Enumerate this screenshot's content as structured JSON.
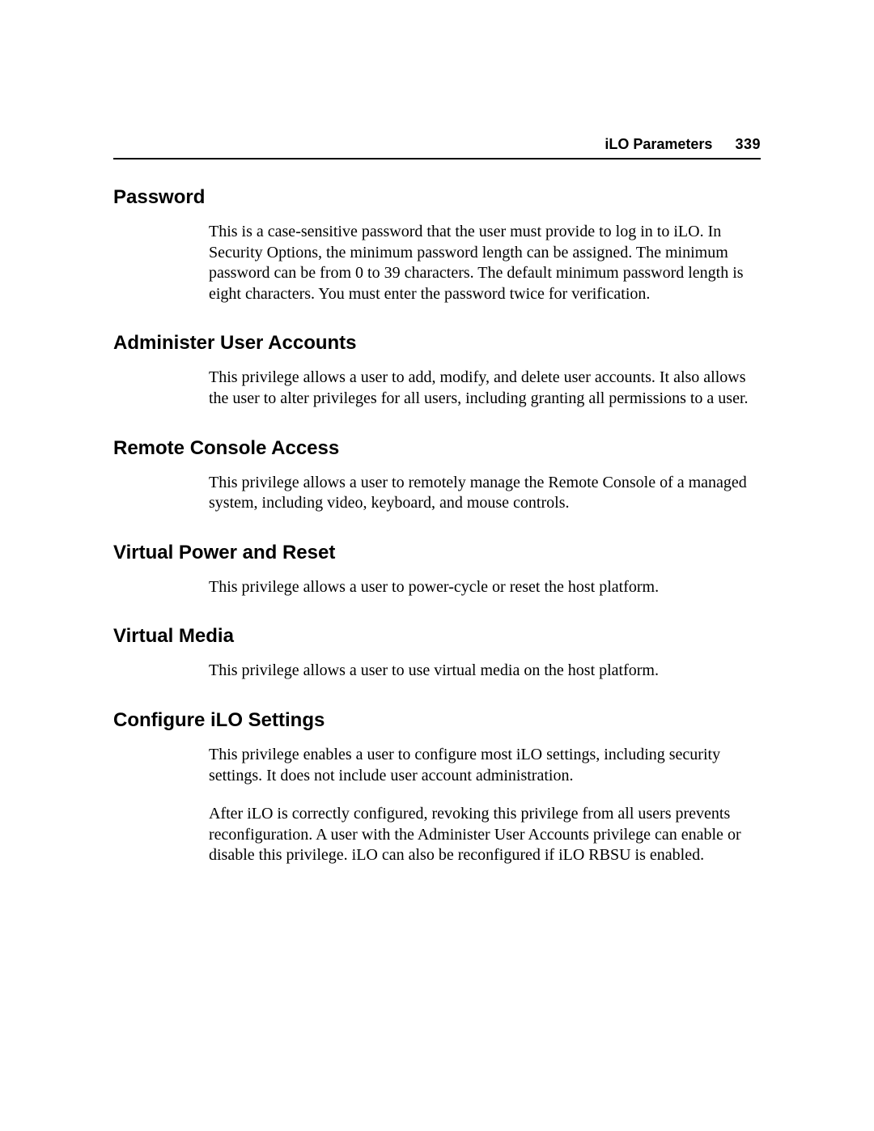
{
  "header": {
    "title": "iLO Parameters",
    "page_number": "339"
  },
  "sections": [
    {
      "heading": "Password",
      "paragraphs": [
        "This is a case-sensitive password that the user must provide to log in to iLO. In Security Options, the minimum password length can be assigned. The minimum password can be from 0 to 39 characters. The default minimum password length is eight characters. You must enter the password twice for verification."
      ]
    },
    {
      "heading": "Administer User Accounts",
      "paragraphs": [
        "This privilege allows a user to add, modify, and delete user accounts. It also allows the user to alter privileges for all users, including granting all permissions to a user."
      ]
    },
    {
      "heading": "Remote Console Access",
      "paragraphs": [
        "This privilege allows a user to remotely manage the Remote Console of a managed system, including video, keyboard, and mouse controls."
      ]
    },
    {
      "heading": "Virtual Power and Reset",
      "paragraphs": [
        "This privilege allows a user to power-cycle or reset the host platform."
      ]
    },
    {
      "heading": "Virtual Media",
      "paragraphs": [
        "This privilege allows a user to use virtual media on the host platform."
      ]
    },
    {
      "heading": "Configure iLO Settings",
      "paragraphs": [
        "This privilege enables a user to configure most iLO settings, including security settings. It does not include user account administration.",
        "After iLO is correctly configured, revoking this privilege from all users prevents reconfiguration. A user with the Administer User Accounts privilege can enable or disable this privilege. iLO can also be reconfigured if iLO RBSU is enabled."
      ]
    }
  ]
}
